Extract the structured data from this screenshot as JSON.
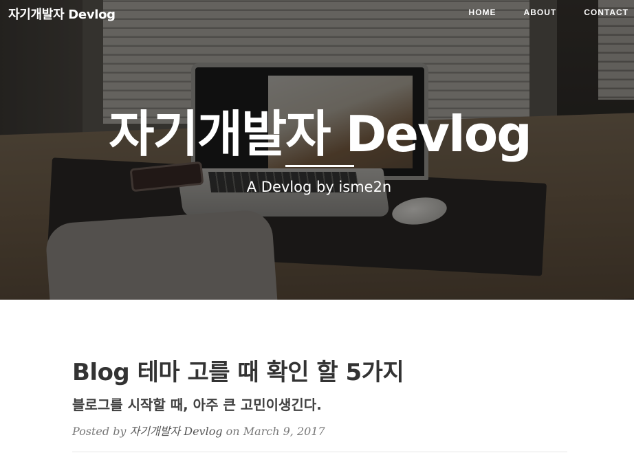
{
  "nav": {
    "brand": "자기개발자 Devlog",
    "links": [
      "HOME",
      "ABOUT",
      "CONTACT"
    ]
  },
  "hero": {
    "title": "자기개발자 Devlog",
    "subtitle": "A Devlog by isme2n"
  },
  "post": {
    "title": "Blog 테마 고를 때 확인 할 5가지",
    "subtitle": "블로그를 시작할 때, 아주 큰 고민이생긴다.",
    "meta_prefix": "Posted by",
    "author": "자기개발자 Devlog",
    "meta_on": "on",
    "date": "March 9, 2017"
  }
}
